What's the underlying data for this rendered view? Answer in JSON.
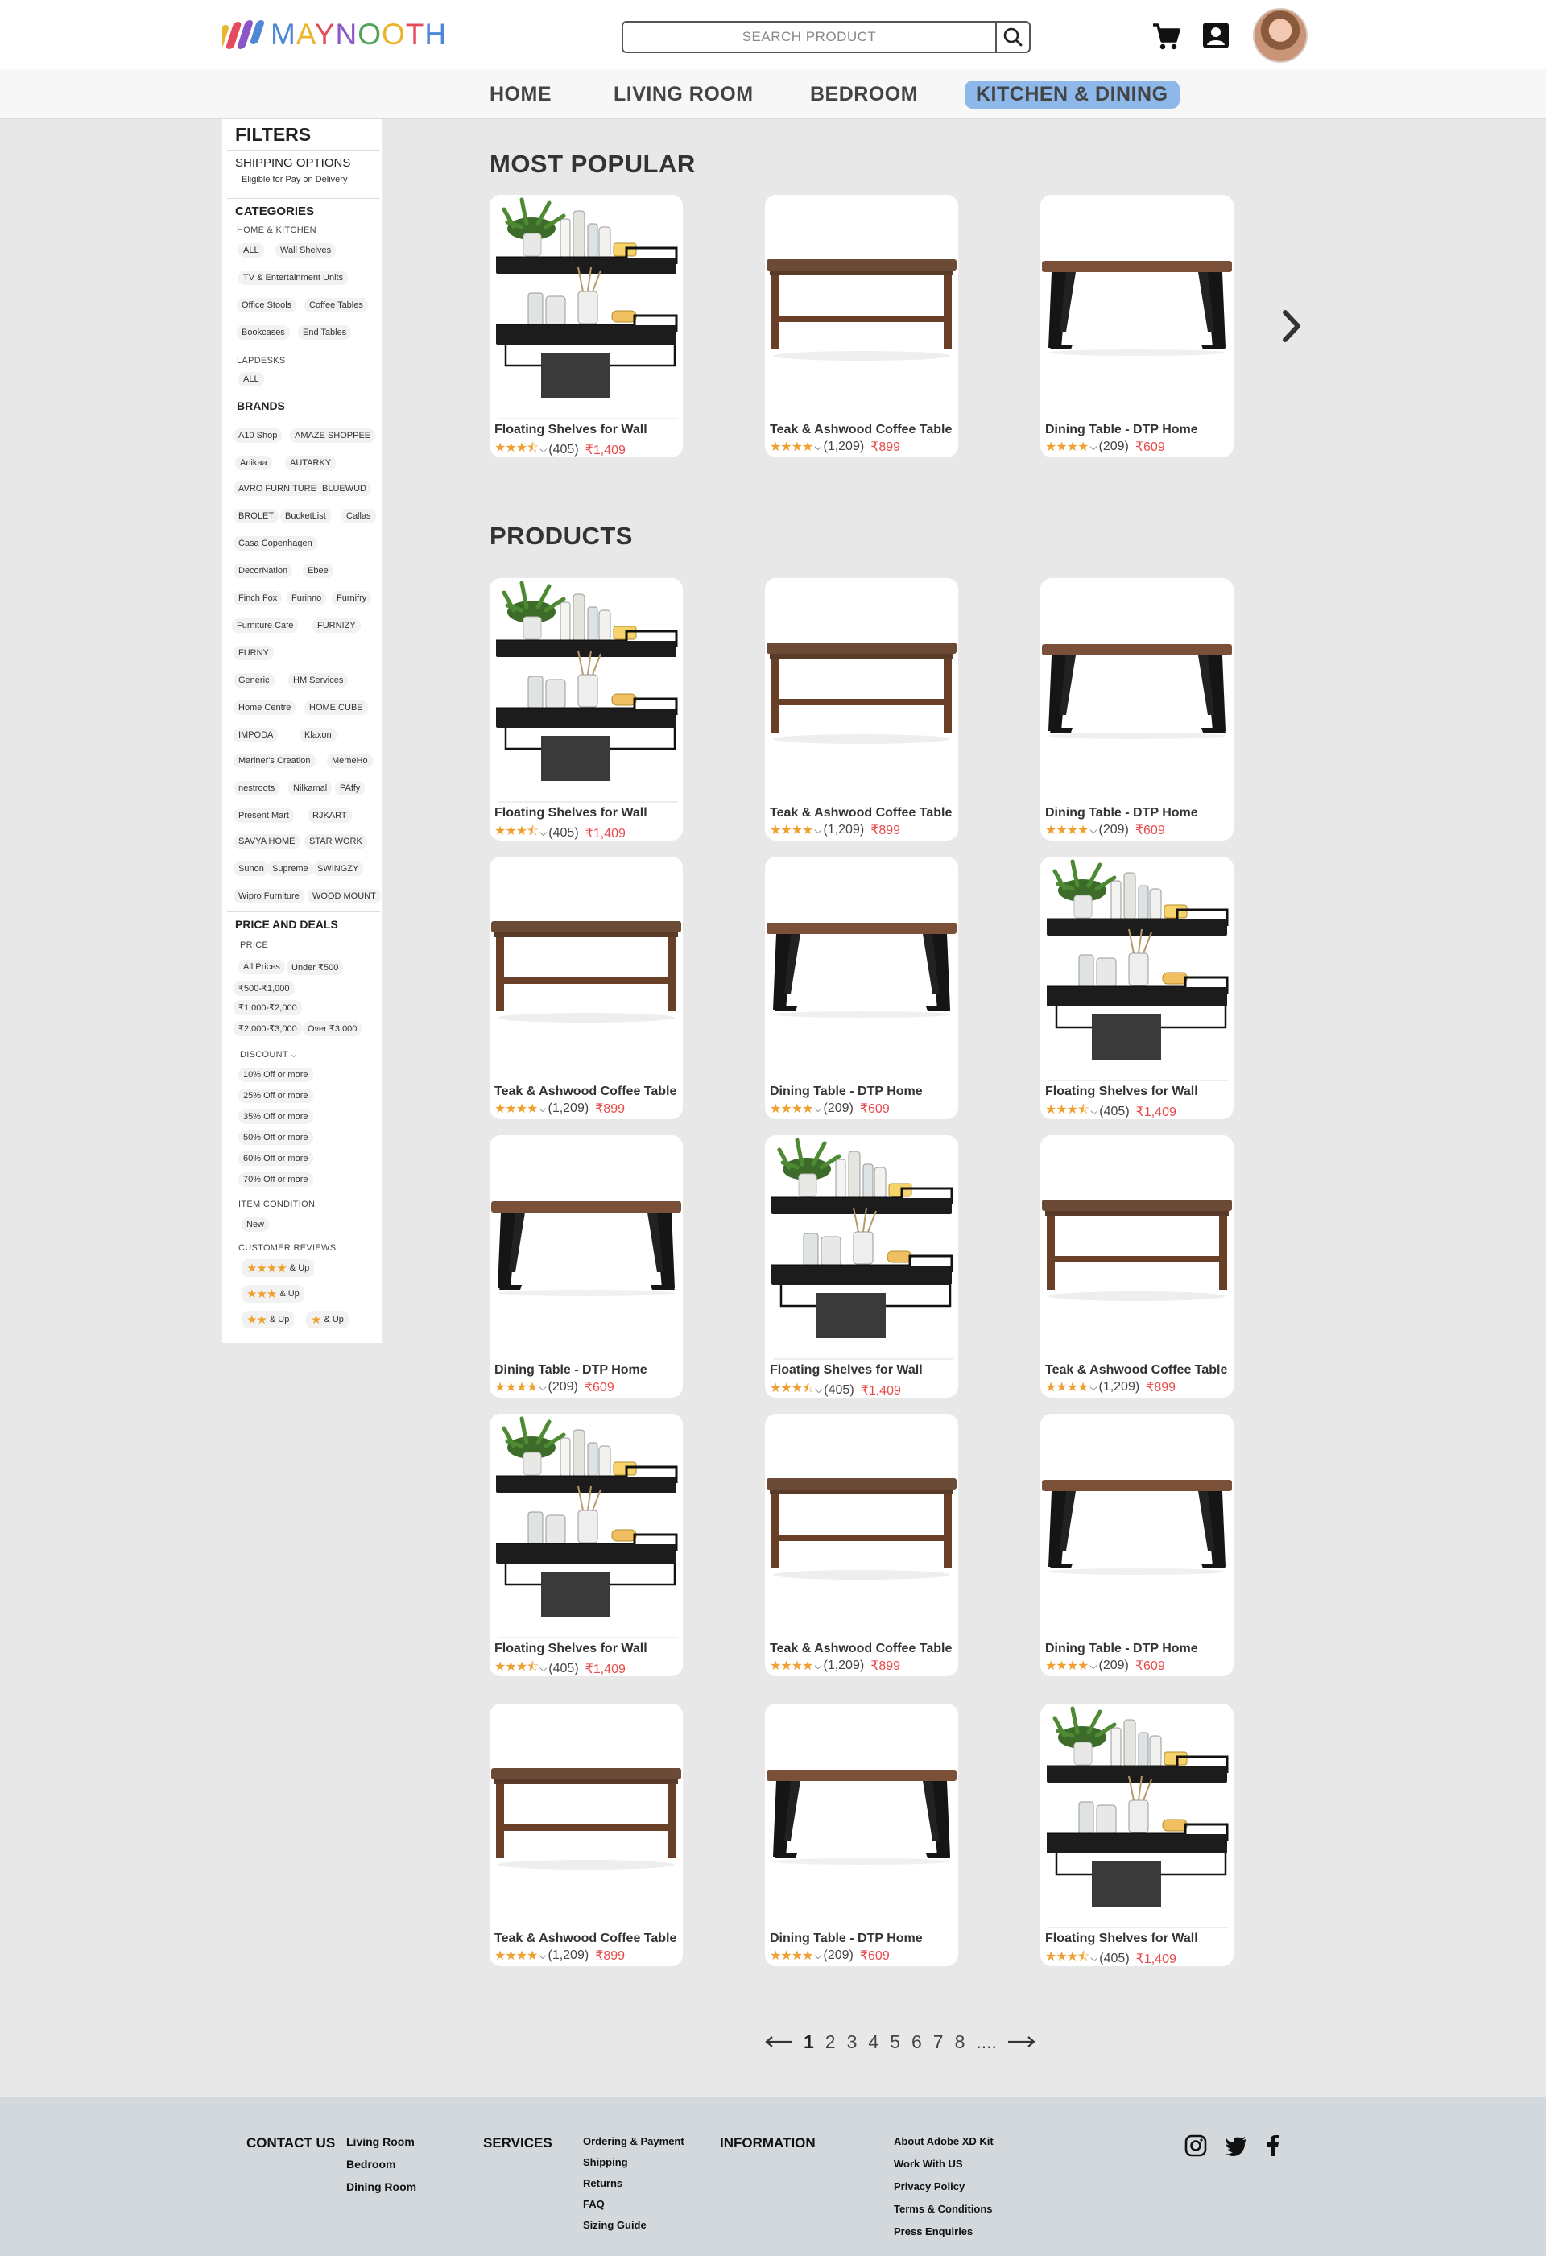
{
  "header": {
    "logo_letters": [
      "M",
      "A",
      "Y",
      "N",
      "O",
      "O",
      "T",
      "H"
    ],
    "search_placeholder": "SEARCH PRODUCT",
    "icons": [
      "search-icon",
      "cart-icon",
      "account-icon",
      "avatar"
    ]
  },
  "nav": {
    "items": [
      "HOME",
      "LIVING ROOM",
      "BEDROOM",
      "KITCHEN & DINING"
    ],
    "active": "KITCHEN & DINING"
  },
  "sidebar": {
    "title": "FILTERS",
    "shipping_title": "SHIPPING OPTIONS",
    "shipping_option": "Eligible for Pay on Delivery",
    "categories_title": "CATEGORIES",
    "home_kitchen": "HOME & KITCHEN",
    "categories": [
      "ALL",
      "Wall Shelves",
      "TV & Entertainment Units",
      "Office Stools",
      "Coffee Tables",
      "Bookcases",
      "End Tables"
    ],
    "lapdesks": "LAPDESKS",
    "lapdesks_all": "ALL",
    "brands_title": "BRANDS",
    "brands": [
      "A10 Shop",
      "AMAZE SHOPPEE",
      "Anikaa",
      "AUTARKY",
      "AVRO FURNITURE",
      "BLUEWUD",
      "BROLET",
      "BucketList",
      "Callas",
      "Casa Copenhagen",
      "DecorNation",
      "Ebee",
      "Finch Fox",
      "Furinno",
      "Furnifry",
      "Furniture Cafe",
      "FURNIZY",
      "FURNY",
      "Generic",
      "HM Services",
      "Home Centre",
      "HOME CUBE",
      "IMPODA",
      "Klaxon",
      "Mariner's Creation",
      "MemeHo",
      "nestroots",
      "Nilkamal",
      "PAffy",
      "Present Mart",
      "RJKART",
      "SAVYA HOME",
      "STAR WORK",
      "Sunon",
      "Supreme",
      "SWINGZY",
      "Wipro Furniture",
      "WOOD MOUNT"
    ],
    "price_deals_title": "PRICE AND DEALS",
    "price_sub": "PRICE",
    "prices": [
      "All Prices",
      "Under ₹500",
      "₹500-₹1,000",
      "₹1,000-₹2,000",
      "₹2,000-₹3,000",
      "Over ₹3,000"
    ],
    "discount_sub": "DISCOUNT",
    "discounts": [
      "10% Off or more",
      "25% Off or more",
      "35% Off or more",
      "50% Off or more",
      "60% Off or more",
      "70% Off or more"
    ],
    "condition_sub": "ITEM CONDITION",
    "condition_new": "New",
    "reviews_sub": "CUSTOMER REVIEWS",
    "reviews": [
      {
        "stars": "★★★★",
        "label": "& Up"
      },
      {
        "stars": "★★★",
        "label": "& Up"
      },
      {
        "stars": "★★",
        "label": "& Up"
      },
      {
        "stars": "★",
        "label": "& Up"
      }
    ]
  },
  "products": {
    "shelves": {
      "name": "Floating Shelves for Wall",
      "rating": 3.5,
      "stars": "★★★⯪",
      "reviews": "(405)",
      "price": "₹1,409"
    },
    "coffee": {
      "name": "Teak & Ashwood Coffee Table",
      "rating": 4,
      "stars": "★★★★",
      "reviews": "(1,209)",
      "price": "₹899"
    },
    "dining": {
      "name": "Dining Table - DTP Home",
      "rating": 4,
      "stars": "★★★★",
      "reviews": "(209)",
      "price": "₹609"
    }
  },
  "most_popular": {
    "title": "MOST POPULAR",
    "items": [
      "shelves",
      "coffee",
      "dining"
    ]
  },
  "product_list": {
    "title": "PRODUCTS",
    "items": [
      "shelves",
      "coffee",
      "dining",
      "coffee",
      "dining",
      "shelves",
      "dining",
      "shelves",
      "coffee",
      "shelves",
      "coffee",
      "dining",
      "coffee",
      "dining",
      "shelves"
    ]
  },
  "pagination": {
    "pages": [
      "1",
      "2",
      "3",
      "4",
      "5",
      "6",
      "7",
      "8"
    ],
    "current": "1",
    "more": "...."
  },
  "footer": {
    "contact_title": "CONTACT US",
    "contact_links": [
      "Living Room",
      "Bedroom",
      "Dining Room"
    ],
    "services_title": "SERVICES",
    "services_links": [
      "Ordering & Payment",
      "Shipping",
      "Returns",
      "FAQ",
      "Sizing Guide"
    ],
    "info_title": "INFORMATION",
    "info_links": [
      "About Adobe XD Kit",
      "Work With US",
      "Privacy Policy",
      "Terms & Conditions",
      "Press Enquiries"
    ],
    "social": [
      "instagram-icon",
      "twitter-icon",
      "facebook-icon"
    ]
  },
  "colors": {
    "accent_nav": "#8fb8ea",
    "price": "#e84a4a",
    "star": "#f0a030",
    "footer_bg": "#d3d8dd"
  }
}
